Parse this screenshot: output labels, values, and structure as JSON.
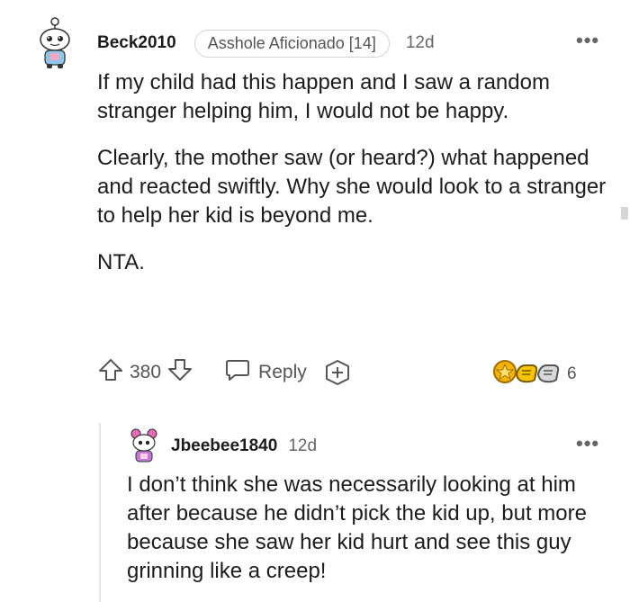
{
  "comment": {
    "username": "Beck2010",
    "flair": "Asshole Aficionado [14]",
    "timestamp": "12d",
    "more_label": "•••",
    "paragraphs": [
      "If my child had this happen and I saw a random stranger helping him, I would not be happy.",
      "Clearly, the mother saw (or heard?) what happened and reacted swiftly. Why she would look to a stranger to help her kid is beyond me.",
      "NTA."
    ],
    "votes": "380",
    "reply_label": "Reply",
    "award_count": "6"
  },
  "reply": {
    "username": "Jbeebee1840",
    "timestamp": "12d",
    "more_label": "•••",
    "text": "I don’t think she was necessarily looking at him after because he didn’t pick the kid up, but more because she saw her kid hurt and see this guy grinning like a creep!"
  },
  "icons": {
    "avatar_main": "snoo-avatar-icon",
    "avatar_reply": "snoo-avatar-icon",
    "upvote": "upvote-arrow-icon",
    "downvote": "downvote-arrow-icon",
    "reply": "comment-bubble-icon",
    "add_award": "add-award-icon",
    "awards": [
      "gold-award-icon",
      "wholesome-award-icon",
      "silver-award-icon"
    ]
  },
  "colors": {
    "text": "#1c1c1c",
    "muted": "#666666",
    "border": "#d4d4d4",
    "award_gold": "#f5b400",
    "award_silver": "#a0a0a0"
  }
}
